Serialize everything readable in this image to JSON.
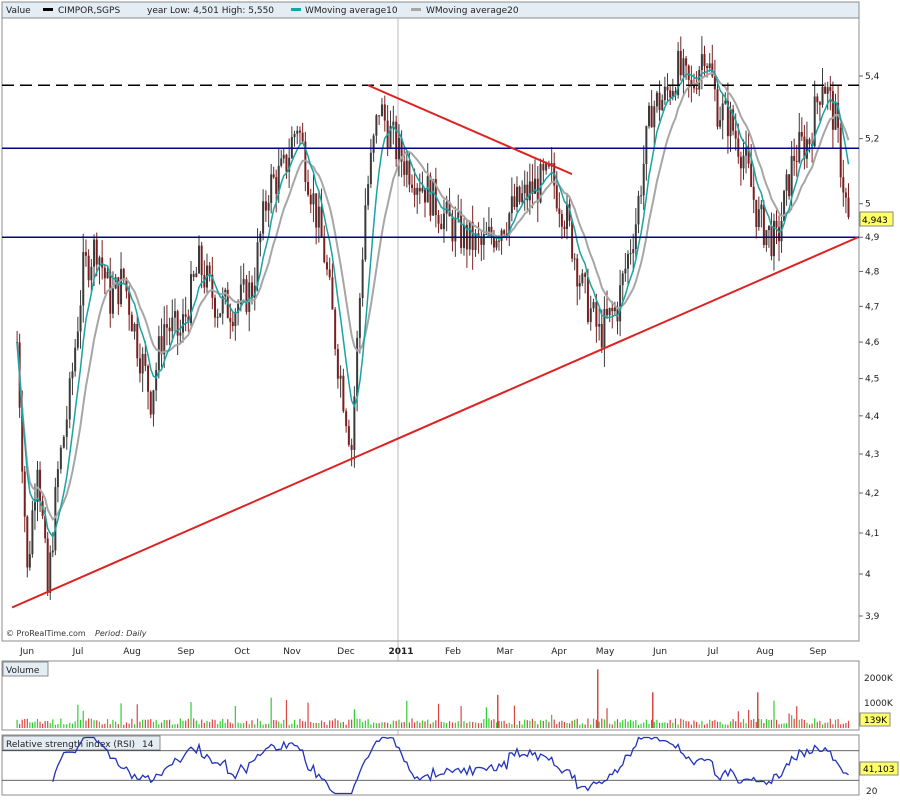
{
  "header": {
    "value_label": "Value",
    "symbol": "CIMPOR,SGPS",
    "range_text": "year Low: 4,501 High: 5,550",
    "legend_ma10": "WMoving average10",
    "legend_ma20": "WMoving average20"
  },
  "footer": {
    "credit": "© ProRealTime.com",
    "period_label": "Period",
    "period_value": ": Daily"
  },
  "colors": {
    "price_up": "#3a3a3a",
    "price_down": "#7a1f1f",
    "ma10": "#1aa3a3",
    "ma20": "#a6a6a6",
    "trendline": "#dd2222",
    "support": "#00008b",
    "dashed": "#000000",
    "volume_up": "#33cc33",
    "volume_down": "#dd4444",
    "rsi": "#2233bb"
  },
  "chart_data": [
    {
      "type": "candlestick",
      "y_axis": {
        "ticks": [
          "5,4",
          "5,2",
          "5",
          "4,9",
          "4,8",
          "4,7",
          "4,6",
          "4,5",
          "4,4",
          "4,3",
          "4,2",
          "4,1",
          "4",
          "3,9"
        ],
        "tick_values": [
          5.4,
          5.2,
          5.0,
          4.9,
          4.8,
          4.7,
          4.6,
          4.5,
          4.4,
          4.3,
          4.2,
          4.1,
          4.0,
          3.9
        ],
        "scale": "log"
      },
      "x_axis": {
        "labels": [
          "Jun",
          "Jul",
          "Aug",
          "Sep",
          "Oct",
          "Nov",
          "Dec",
          "2011",
          "Feb",
          "Mar",
          "Apr",
          "May",
          "Jun",
          "Jul",
          "Aug",
          "Sep"
        ]
      },
      "last_value_label": "4,943",
      "last_value": 4.943,
      "year_low": 4.501,
      "year_high": 5.55,
      "horizontal_lines": [
        {
          "name": "resistance-dashed",
          "value": 5.37
        },
        {
          "name": "support-upper",
          "value": 5.17
        },
        {
          "name": "support-lower",
          "value": 4.9
        }
      ],
      "trendlines": [
        {
          "name": "rising-support",
          "from": [
            "Jun",
            3.92
          ],
          "to": [
            "Sep",
            4.9
          ]
        },
        {
          "name": "falling-resistance",
          "from": [
            "Dec",
            5.37
          ],
          "to": [
            "Apr",
            5.09
          ]
        }
      ],
      "close_path": [
        [
          "Jun",
          4.6
        ],
        [
          "Jun",
          4.0
        ],
        [
          "Jun",
          4.3
        ],
        [
          "Jun",
          3.95
        ],
        [
          "Jun",
          4.25
        ],
        [
          "Jul",
          4.45
        ],
        [
          "Jul",
          4.8
        ],
        [
          "Jul",
          4.88
        ],
        [
          "Jul",
          4.72
        ],
        [
          "Aug",
          4.78
        ],
        [
          "Aug",
          4.6
        ],
        [
          "Aug",
          4.45
        ],
        [
          "Aug",
          4.65
        ],
        [
          "Sep",
          4.62
        ],
        [
          "Sep",
          4.82
        ],
        [
          "Sep",
          4.7
        ],
        [
          "Oct",
          4.7
        ],
        [
          "Oct",
          4.75
        ],
        [
          "Oct",
          5.05
        ],
        [
          "Nov",
          5.1
        ],
        [
          "Nov",
          5.25
        ],
        [
          "Nov",
          5.05
        ],
        [
          "Nov",
          4.85
        ],
        [
          "Dec",
          4.55
        ],
        [
          "Dec",
          4.32
        ],
        [
          "Dec",
          5.0
        ],
        [
          "Dec",
          5.3
        ],
        [
          "2011",
          5.15
        ],
        [
          "2011",
          5.05
        ],
        [
          "Feb",
          4.95
        ],
        [
          "Feb",
          4.9
        ],
        [
          "Feb",
          4.87
        ],
        [
          "Mar",
          4.93
        ],
        [
          "Mar",
          5.0
        ],
        [
          "Mar",
          5.05
        ],
        [
          "Apr",
          5.08
        ],
        [
          "Apr",
          4.95
        ],
        [
          "Apr",
          4.75
        ],
        [
          "May",
          4.62
        ],
        [
          "May",
          4.7
        ],
        [
          "May",
          4.95
        ],
        [
          "Jun",
          5.3
        ],
        [
          "Jun",
          5.33
        ],
        [
          "Jun",
          5.42
        ],
        [
          "Jun",
          5.35
        ],
        [
          "Jul",
          5.5
        ],
        [
          "Jul",
          5.3
        ],
        [
          "Jul",
          5.25
        ],
        [
          "Jul",
          5.15
        ],
        [
          "Aug",
          4.95
        ],
        [
          "Aug",
          4.88
        ],
        [
          "Aug",
          5.15
        ],
        [
          "Sep",
          5.2
        ],
        [
          "Sep",
          5.4
        ],
        [
          "Sep",
          5.25
        ],
        [
          "Sep",
          4.94
        ]
      ]
    },
    {
      "type": "bar",
      "panel_label": "Volume",
      "y_axis": {
        "ticks": [
          "2000K",
          "1000K"
        ],
        "tick_values": [
          2000,
          1000
        ]
      },
      "last_value_label": "139K",
      "last_value": 139,
      "spikes": [
        {
          "month": "May",
          "value": 2300
        },
        {
          "month": "Jun",
          "value": 1400
        },
        {
          "month": "Mar",
          "value": 1300
        },
        {
          "month": "Aug",
          "value": 1400
        }
      ]
    },
    {
      "type": "line",
      "panel_label": "Relative strength index (RSI)",
      "panel_param": "14",
      "y_axis": {
        "ticks": [
          "20"
        ],
        "tick_values": [
          20
        ]
      },
      "last_value_label": "41,103",
      "last_value": 41.103,
      "reference_lines": [
        30,
        70
      ]
    }
  ]
}
